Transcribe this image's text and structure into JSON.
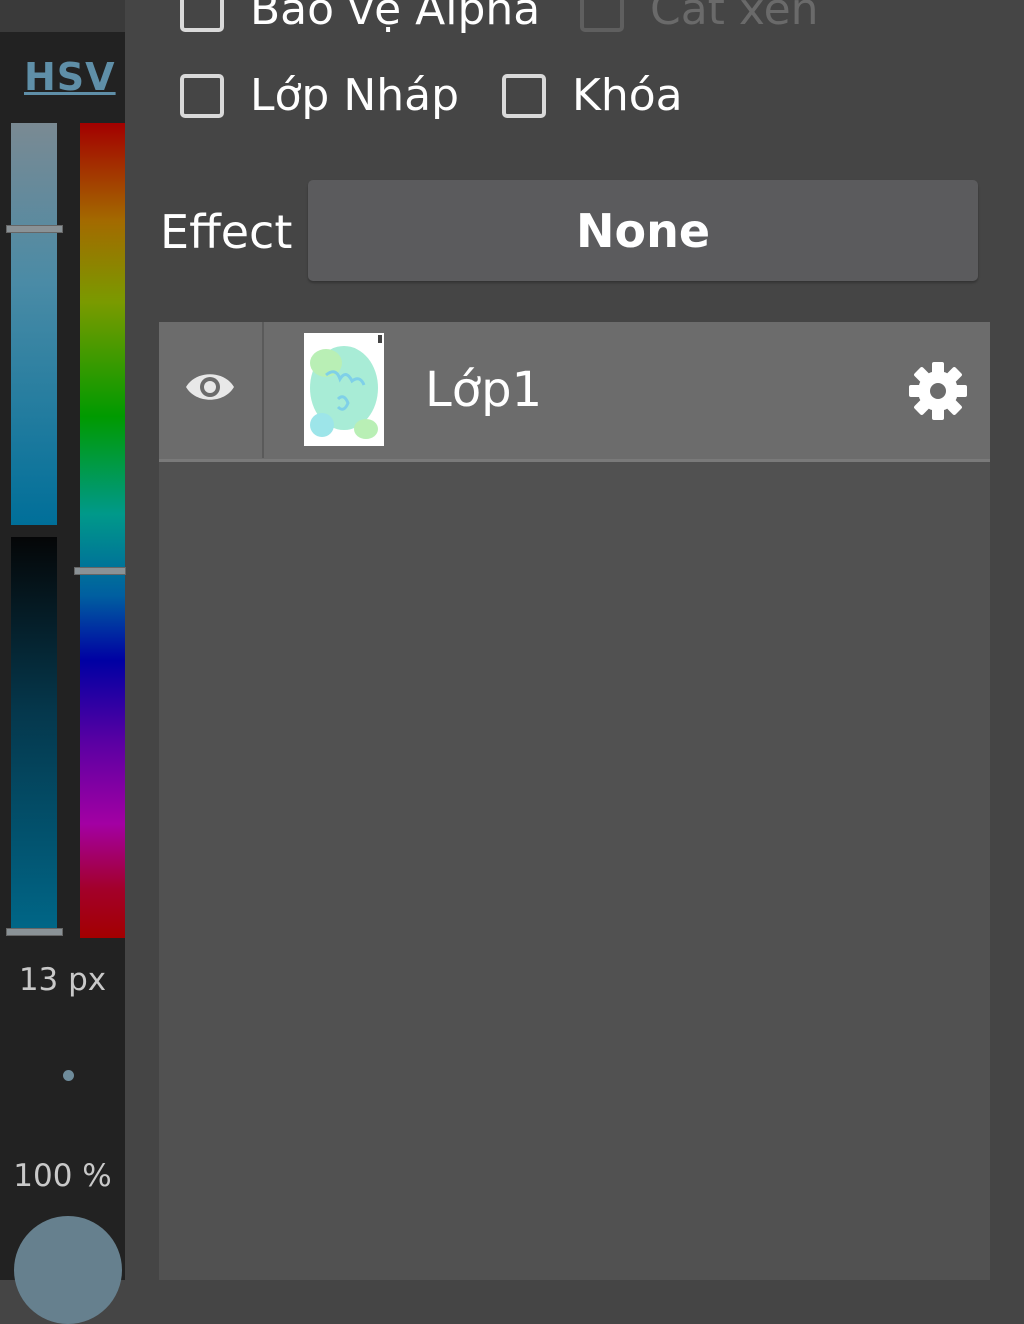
{
  "layer_options": {
    "protect_alpha": {
      "label": "Bảo vệ Alpha",
      "checked": false
    },
    "clipping": {
      "label": "Cắt xén",
      "checked": false,
      "disabled": true
    },
    "draft_layer": {
      "label": "Lớp Nháp",
      "checked": false
    },
    "lock": {
      "label": "Khóa",
      "checked": false
    }
  },
  "effect": {
    "label": "Effect",
    "value": "None"
  },
  "color_panel": {
    "mode_label": "HSV",
    "brush_size": "13 px",
    "opacity": "100 %",
    "saturation_level": 0.26,
    "value_level": 1.0,
    "hue_level": 0.55,
    "current_color": "#66808e"
  },
  "layers": [
    {
      "name": "Lớp1",
      "visible": true,
      "icon": "eye-icon",
      "settings_icon": "gear-icon"
    }
  ]
}
